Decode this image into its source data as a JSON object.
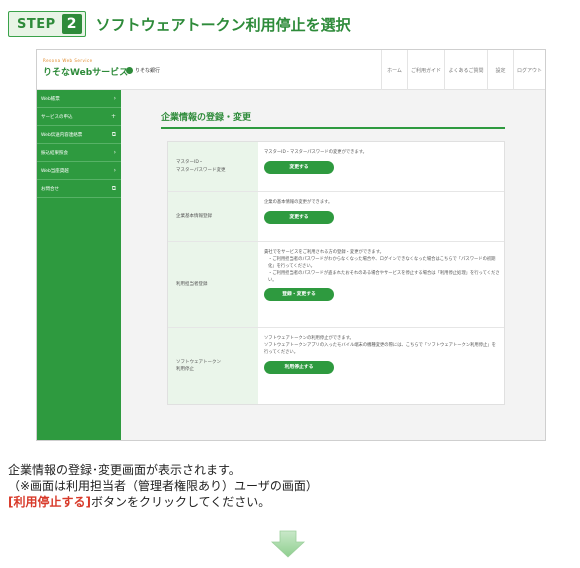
{
  "step": {
    "label": "STEP",
    "number": "2",
    "title": "ソフトウェアトークン利用停止を選択"
  },
  "app": {
    "brand_small": "Resona Web Service",
    "brand_main": "りそなWebサービス",
    "bank_name": "りそな銀行",
    "topnav": [
      "ホーム",
      "ご利用ガイド",
      "よくあるご質問",
      "設定",
      "ログアウト"
    ]
  },
  "sidebar": {
    "items": [
      {
        "label": "Web帳票",
        "icon": "chevron-right"
      },
      {
        "label": "サービスの申込",
        "icon": "plus"
      },
      {
        "label": "Web伝送内容連絡票",
        "icon": "external-link"
      },
      {
        "label": "振込結果照会",
        "icon": "chevron-right"
      },
      {
        "label": "Web当座貸越",
        "icon": "chevron-right"
      },
      {
        "label": "お問合せ",
        "icon": "external-link"
      }
    ]
  },
  "main": {
    "title": "企業情報の登録・変更",
    "rows": [
      {
        "label": "マスターID・\nマスターパスワード変更",
        "lines": [
          "マスターID・マスターパスワードの変更ができます。"
        ],
        "button": "変更する"
      },
      {
        "label": "企業基本情報登録",
        "lines": [
          "企業の基本情報の変更ができます。"
        ],
        "button": "変更する"
      },
      {
        "label": "利用担当者登録",
        "lines": [
          "貴社でをサービスをご利用される方の登録・変更ができます。",
          "・ご利用担当者のパスワードがわからなくなった場合や、ログインできなくなった場合はこちらで「パスワードの初期化」を行ってください。",
          "・ご利用担当者のパスワードが盗まれたおそれのある場合やサービスを停止する場合は「利用停止処理」を行ってください。"
        ],
        "button": "登録・変更する"
      },
      {
        "label": "ソフトウェアトークン\n利用停止",
        "lines": [
          "ソフトウェアトークンの利用停止ができます。",
          "ソフトウェアトークンアプリの入ったモバイル端末の機種変更の際には、こちらで「ソフトウェアトークン利用停止」を行ってください。"
        ],
        "button": "利用停止する"
      }
    ]
  },
  "instructions": {
    "line1": "企業情報の登録･変更画面が表示されます。",
    "line2": "（※画面は利用担当者（管理者権限あり）ユーザの画面）",
    "highlight": "[利用停止する]",
    "line3_rest": "ボタンをクリックしてください。"
  },
  "colors": {
    "brand_green": "#2e9a3f",
    "dark_green": "#2e8b3a",
    "highlight_red": "#d83a2a",
    "label_bg": "#eaf5ea"
  }
}
